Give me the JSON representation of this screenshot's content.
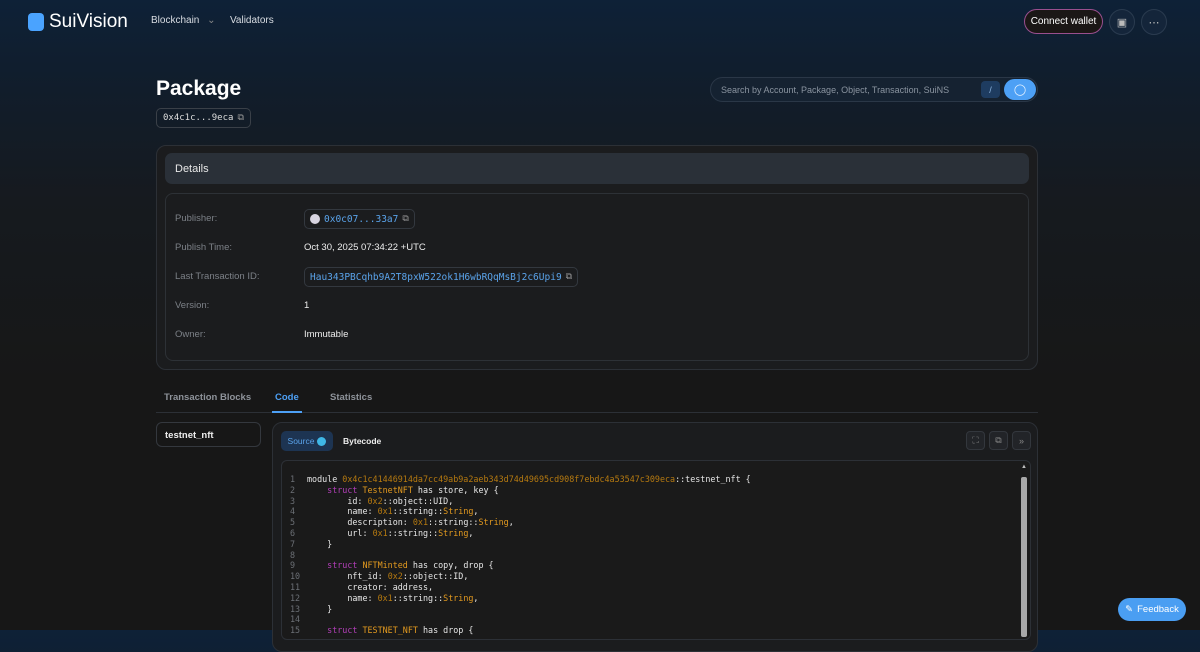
{
  "nav": {
    "brand": "SuiVision",
    "links": [
      "Blockchain",
      "Validators"
    ],
    "connect_wallet": "Connect wallet"
  },
  "search": {
    "placeholder": "Search by Account, Package, Object, Transaction, SuiNS",
    "shortcut": "/"
  },
  "page": {
    "title": "Package",
    "address": "0x4c1c...9eca"
  },
  "details": {
    "heading": "Details",
    "rows": [
      {
        "label": "Publisher:",
        "value": "0x0c07...33a7"
      },
      {
        "label": "Publish Time:",
        "value": "Oct 30, 2025 07:34:22 +UTC"
      },
      {
        "label": "Last Transaction ID:",
        "value": "Hau343PBCqhb9A2T8pxW522ok1H6wbRQqMsBj2c6Upi9"
      },
      {
        "label": "Version:",
        "value": "1"
      },
      {
        "label": "Owner:",
        "value": "Immutable"
      }
    ]
  },
  "tabs": [
    {
      "label": "Transaction Blocks"
    },
    {
      "label": "Code",
      "active": true
    },
    {
      "label": "Statistics"
    }
  ],
  "modules": [
    "testnet_nft"
  ],
  "code_view": {
    "source_label": "Source",
    "bytecode_label": "Bytecode",
    "lines": [
      [
        [
          "pl",
          "module "
        ],
        [
          "ad",
          "0x4c1c41446914da7cc49ab9a2aeb343d74d49695cd908f7ebdc4a53547c309eca"
        ],
        [
          "pl",
          "::testnet_nft {"
        ]
      ],
      [
        [
          "pl",
          "    "
        ],
        [
          "kw",
          "struct "
        ],
        [
          "ty",
          "TestnetNFT"
        ],
        [
          "pl",
          " has store, key {"
        ]
      ],
      [
        [
          "pl",
          "        id: "
        ],
        [
          "ad",
          "0x2"
        ],
        [
          "pl",
          "::object::UID,"
        ]
      ],
      [
        [
          "pl",
          "        name: "
        ],
        [
          "ad",
          "0x1"
        ],
        [
          "pl",
          "::string::"
        ],
        [
          "ty",
          "String"
        ],
        [
          "pl",
          ","
        ]
      ],
      [
        [
          "pl",
          "        description: "
        ],
        [
          "ad",
          "0x1"
        ],
        [
          "pl",
          "::string::"
        ],
        [
          "ty",
          "String"
        ],
        [
          "pl",
          ","
        ]
      ],
      [
        [
          "pl",
          "        url: "
        ],
        [
          "ad",
          "0x1"
        ],
        [
          "pl",
          "::string::"
        ],
        [
          "ty",
          "String"
        ],
        [
          "pl",
          ","
        ]
      ],
      [
        [
          "pl",
          "    }"
        ]
      ],
      [],
      [
        [
          "pl",
          "    "
        ],
        [
          "kw",
          "struct "
        ],
        [
          "ty",
          "NFTMinted"
        ],
        [
          "pl",
          " has copy, drop {"
        ]
      ],
      [
        [
          "pl",
          "        nft_id: "
        ],
        [
          "ad",
          "0x2"
        ],
        [
          "pl",
          "::object::ID,"
        ]
      ],
      [
        [
          "pl",
          "        creator: address,"
        ]
      ],
      [
        [
          "pl",
          "        name: "
        ],
        [
          "ad",
          "0x1"
        ],
        [
          "pl",
          "::string::"
        ],
        [
          "ty",
          "String"
        ],
        [
          "pl",
          ","
        ]
      ],
      [
        [
          "pl",
          "    }"
        ]
      ],
      [],
      [
        [
          "pl",
          "    "
        ],
        [
          "kw",
          "struct "
        ],
        [
          "ty",
          "TESTNET_NFT"
        ],
        [
          "pl",
          " has drop {"
        ]
      ]
    ]
  },
  "feedback": "Feedback",
  "colors": {
    "accent": "#4da0f5",
    "keyword": "#b33fb9",
    "type": "#e39a1f"
  }
}
